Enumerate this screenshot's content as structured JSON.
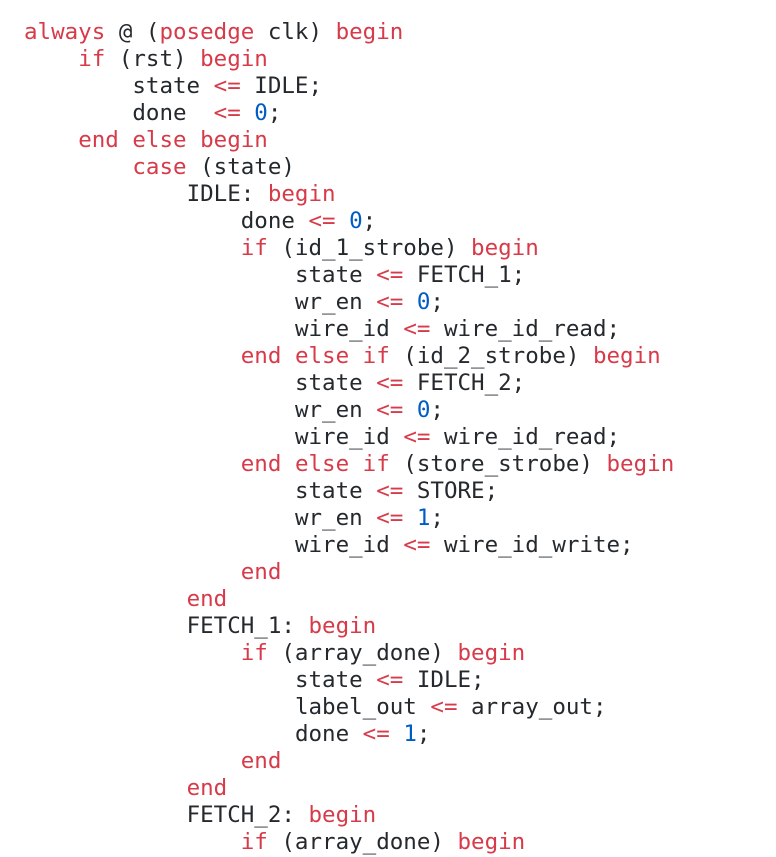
{
  "colors": {
    "keyword": "#d73a49",
    "operator": "#d73a49",
    "number": "#005cc5",
    "text": "#24292e",
    "background": "#ffffff"
  },
  "code": {
    "language": "verilog",
    "lines": [
      {
        "indent": 0,
        "tokens": [
          {
            "t": "always",
            "k": "kw"
          },
          {
            "t": " @ (",
            "k": "plain"
          },
          {
            "t": "posedge",
            "k": "kw"
          },
          {
            "t": " clk) ",
            "k": "plain"
          },
          {
            "t": "begin",
            "k": "kw"
          }
        ]
      },
      {
        "indent": 1,
        "tokens": [
          {
            "t": "if",
            "k": "kw"
          },
          {
            "t": " (rst) ",
            "k": "plain"
          },
          {
            "t": "begin",
            "k": "kw"
          }
        ]
      },
      {
        "indent": 2,
        "tokens": [
          {
            "t": "state ",
            "k": "plain"
          },
          {
            "t": "<=",
            "k": "op"
          },
          {
            "t": " IDLE;",
            "k": "plain"
          }
        ]
      },
      {
        "indent": 2,
        "tokens": [
          {
            "t": "done  ",
            "k": "plain"
          },
          {
            "t": "<=",
            "k": "op"
          },
          {
            "t": " ",
            "k": "plain"
          },
          {
            "t": "0",
            "k": "num"
          },
          {
            "t": ";",
            "k": "plain"
          }
        ]
      },
      {
        "indent": 1,
        "tokens": [
          {
            "t": "end",
            "k": "kw"
          },
          {
            "t": " ",
            "k": "plain"
          },
          {
            "t": "else",
            "k": "kw"
          },
          {
            "t": " ",
            "k": "plain"
          },
          {
            "t": "begin",
            "k": "kw"
          }
        ]
      },
      {
        "indent": 2,
        "tokens": [
          {
            "t": "case",
            "k": "kw"
          },
          {
            "t": " (state)",
            "k": "plain"
          }
        ]
      },
      {
        "indent": 3,
        "tokens": [
          {
            "t": "IDLE: ",
            "k": "plain"
          },
          {
            "t": "begin",
            "k": "kw"
          }
        ]
      },
      {
        "indent": 4,
        "tokens": [
          {
            "t": "done ",
            "k": "plain"
          },
          {
            "t": "<=",
            "k": "op"
          },
          {
            "t": " ",
            "k": "plain"
          },
          {
            "t": "0",
            "k": "num"
          },
          {
            "t": ";",
            "k": "plain"
          }
        ]
      },
      {
        "indent": 4,
        "tokens": [
          {
            "t": "if",
            "k": "kw"
          },
          {
            "t": " (id_1_strobe) ",
            "k": "plain"
          },
          {
            "t": "begin",
            "k": "kw"
          }
        ]
      },
      {
        "indent": 5,
        "tokens": [
          {
            "t": "state ",
            "k": "plain"
          },
          {
            "t": "<=",
            "k": "op"
          },
          {
            "t": " FETCH_1;",
            "k": "plain"
          }
        ]
      },
      {
        "indent": 5,
        "tokens": [
          {
            "t": "wr_en ",
            "k": "plain"
          },
          {
            "t": "<=",
            "k": "op"
          },
          {
            "t": " ",
            "k": "plain"
          },
          {
            "t": "0",
            "k": "num"
          },
          {
            "t": ";",
            "k": "plain"
          }
        ]
      },
      {
        "indent": 5,
        "tokens": [
          {
            "t": "wire_id ",
            "k": "plain"
          },
          {
            "t": "<=",
            "k": "op"
          },
          {
            "t": " wire_id_read;",
            "k": "plain"
          }
        ]
      },
      {
        "indent": 4,
        "tokens": [
          {
            "t": "end",
            "k": "kw"
          },
          {
            "t": " ",
            "k": "plain"
          },
          {
            "t": "else",
            "k": "kw"
          },
          {
            "t": " ",
            "k": "plain"
          },
          {
            "t": "if",
            "k": "kw"
          },
          {
            "t": " (id_2_strobe) ",
            "k": "plain"
          },
          {
            "t": "begin",
            "k": "kw"
          }
        ]
      },
      {
        "indent": 5,
        "tokens": [
          {
            "t": "state ",
            "k": "plain"
          },
          {
            "t": "<=",
            "k": "op"
          },
          {
            "t": " FETCH_2;",
            "k": "plain"
          }
        ]
      },
      {
        "indent": 5,
        "tokens": [
          {
            "t": "wr_en ",
            "k": "plain"
          },
          {
            "t": "<=",
            "k": "op"
          },
          {
            "t": " ",
            "k": "plain"
          },
          {
            "t": "0",
            "k": "num"
          },
          {
            "t": ";",
            "k": "plain"
          }
        ]
      },
      {
        "indent": 5,
        "tokens": [
          {
            "t": "wire_id ",
            "k": "plain"
          },
          {
            "t": "<=",
            "k": "op"
          },
          {
            "t": " wire_id_read;",
            "k": "plain"
          }
        ]
      },
      {
        "indent": 4,
        "tokens": [
          {
            "t": "end",
            "k": "kw"
          },
          {
            "t": " ",
            "k": "plain"
          },
          {
            "t": "else",
            "k": "kw"
          },
          {
            "t": " ",
            "k": "plain"
          },
          {
            "t": "if",
            "k": "kw"
          },
          {
            "t": " (store_strobe) ",
            "k": "plain"
          },
          {
            "t": "begin",
            "k": "kw"
          }
        ]
      },
      {
        "indent": 5,
        "tokens": [
          {
            "t": "state ",
            "k": "plain"
          },
          {
            "t": "<=",
            "k": "op"
          },
          {
            "t": " STORE;",
            "k": "plain"
          }
        ]
      },
      {
        "indent": 5,
        "tokens": [
          {
            "t": "wr_en ",
            "k": "plain"
          },
          {
            "t": "<=",
            "k": "op"
          },
          {
            "t": " ",
            "k": "plain"
          },
          {
            "t": "1",
            "k": "num"
          },
          {
            "t": ";",
            "k": "plain"
          }
        ]
      },
      {
        "indent": 5,
        "tokens": [
          {
            "t": "wire_id ",
            "k": "plain"
          },
          {
            "t": "<=",
            "k": "op"
          },
          {
            "t": " wire_id_write;",
            "k": "plain"
          }
        ]
      },
      {
        "indent": 4,
        "tokens": [
          {
            "t": "end",
            "k": "kw"
          }
        ]
      },
      {
        "indent": 3,
        "tokens": [
          {
            "t": "end",
            "k": "kw"
          }
        ]
      },
      {
        "indent": 3,
        "tokens": [
          {
            "t": "FETCH_1: ",
            "k": "plain"
          },
          {
            "t": "begin",
            "k": "kw"
          }
        ]
      },
      {
        "indent": 4,
        "tokens": [
          {
            "t": "if",
            "k": "kw"
          },
          {
            "t": " (array_done) ",
            "k": "plain"
          },
          {
            "t": "begin",
            "k": "kw"
          }
        ]
      },
      {
        "indent": 5,
        "tokens": [
          {
            "t": "state ",
            "k": "plain"
          },
          {
            "t": "<=",
            "k": "op"
          },
          {
            "t": " IDLE;",
            "k": "plain"
          }
        ]
      },
      {
        "indent": 5,
        "tokens": [
          {
            "t": "label_out ",
            "k": "plain"
          },
          {
            "t": "<=",
            "k": "op"
          },
          {
            "t": " array_out;",
            "k": "plain"
          }
        ]
      },
      {
        "indent": 5,
        "tokens": [
          {
            "t": "done ",
            "k": "plain"
          },
          {
            "t": "<=",
            "k": "op"
          },
          {
            "t": " ",
            "k": "plain"
          },
          {
            "t": "1",
            "k": "num"
          },
          {
            "t": ";",
            "k": "plain"
          }
        ]
      },
      {
        "indent": 4,
        "tokens": [
          {
            "t": "end",
            "k": "kw"
          }
        ]
      },
      {
        "indent": 3,
        "tokens": [
          {
            "t": "end",
            "k": "kw"
          }
        ]
      },
      {
        "indent": 3,
        "tokens": [
          {
            "t": "FETCH_2: ",
            "k": "plain"
          },
          {
            "t": "begin",
            "k": "kw"
          }
        ]
      },
      {
        "indent": 4,
        "tokens": [
          {
            "t": "if",
            "k": "kw"
          },
          {
            "t": " (array_done) ",
            "k": "plain"
          },
          {
            "t": "begin",
            "k": "kw"
          }
        ]
      }
    ]
  }
}
